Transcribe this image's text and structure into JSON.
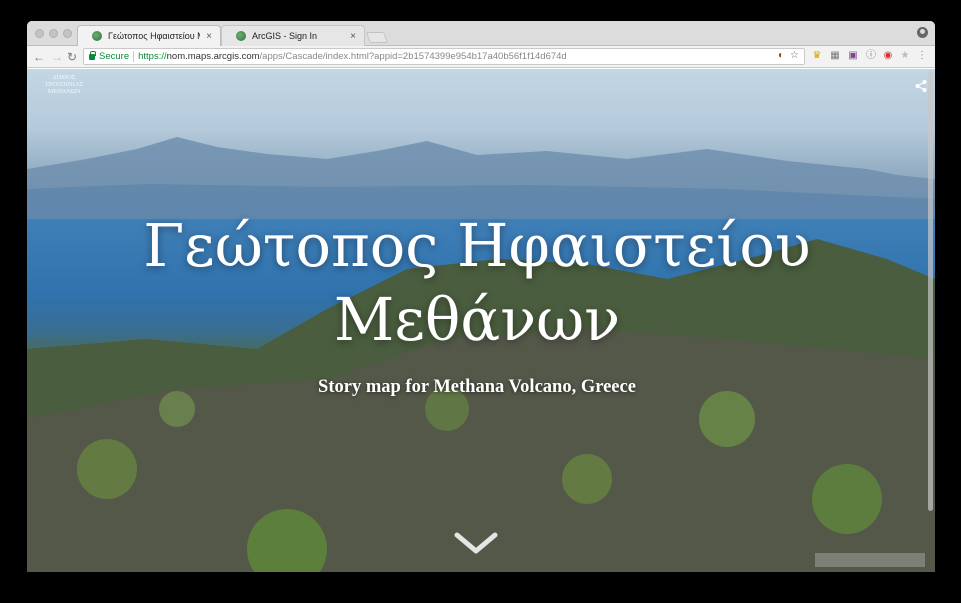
{
  "browser": {
    "tabs": [
      {
        "title": "Γεώτοπος Ηφαιστείου Μεθάνων",
        "active": true
      },
      {
        "title": "ArcGIS - Sign In",
        "active": false
      }
    ],
    "close_glyph": "×",
    "secure_label": "Secure",
    "url": {
      "scheme": "https://",
      "host": "nom.maps.arcgis.com",
      "path": "/apps/Cascade/index.html?appid=2b1574399e954b17a40b56f1f14d674d"
    },
    "icons": [
      "back-icon",
      "forward-icon",
      "reload-icon",
      "lock-icon",
      "translate-icon",
      "star-icon",
      "profile-icon",
      "menu-icon"
    ]
  },
  "page": {
    "logo_text": [
      "ΔΗΜΟΣ",
      "ΤΡΟΙΖΗΝΙΑΣ",
      "ΜΕΘΑΝΩΝ"
    ],
    "title_line1": "Γεώτοπος Ηφαιστείου",
    "title_line2": "Μεθάνων",
    "subtitle": "Story map for Methana Volcano, Greece",
    "colors": {
      "title": "#ffffff",
      "sea": "#2f72ad",
      "sky": "#c3d6e4"
    }
  }
}
